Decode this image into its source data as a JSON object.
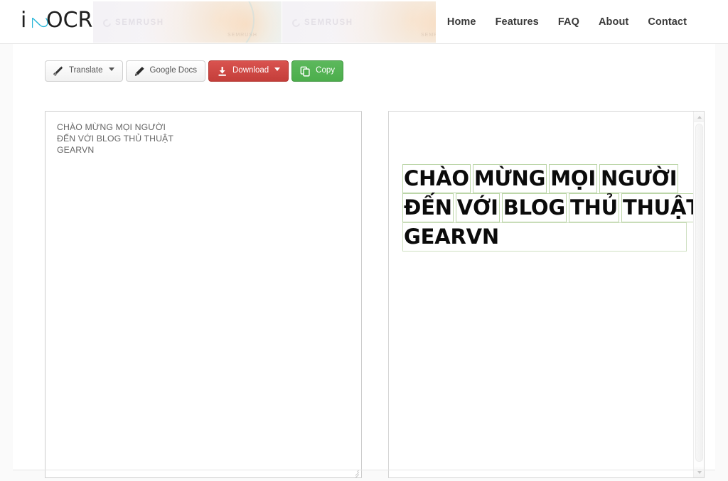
{
  "header": {
    "logo_text": "i2OCR",
    "logo_accent_color": "#29b6d8",
    "nav": [
      {
        "label": "Home",
        "name": "nav-home"
      },
      {
        "label": "Features",
        "name": "nav-features"
      },
      {
        "label": "FAQ",
        "name": "nav-faq"
      },
      {
        "label": "About",
        "name": "nav-about"
      },
      {
        "label": "Contact",
        "name": "nav-contact"
      }
    ],
    "ads": [
      {
        "brand": "SEMRUSH",
        "sub": "SEMRUSH"
      },
      {
        "brand": "SEMRUSH",
        "sub": "SEMRUSH"
      }
    ]
  },
  "toolbar": {
    "translate_label": "Translate",
    "google_docs_label": "Google Docs",
    "download_label": "Download",
    "copy_label": "Copy",
    "download_color": "#d9534f",
    "copy_color": "#5cb85c"
  },
  "result": {
    "text_value": "CHÀO MỪNG MỌI NGƯỜI\nĐẾN VỚI BLOG THỦ THUẬT\nGEARVN",
    "placeholder": ""
  },
  "image_preview": {
    "box_color": "#bcd6a8",
    "lines": [
      {
        "words": [
          "CHÀO",
          "MỪNG",
          "MỌI",
          "NGƯỜI"
        ],
        "boxed_line": false
      },
      {
        "words": [
          "ĐẾN",
          "VỚI",
          "BLOG",
          "THỦ",
          "THUẬT"
        ],
        "boxed_line": false
      },
      {
        "words": [
          "GEARVN"
        ],
        "boxed_line": true
      }
    ]
  },
  "scrollbar": {
    "up_arrow": "▲",
    "down_arrow": "▼"
  }
}
